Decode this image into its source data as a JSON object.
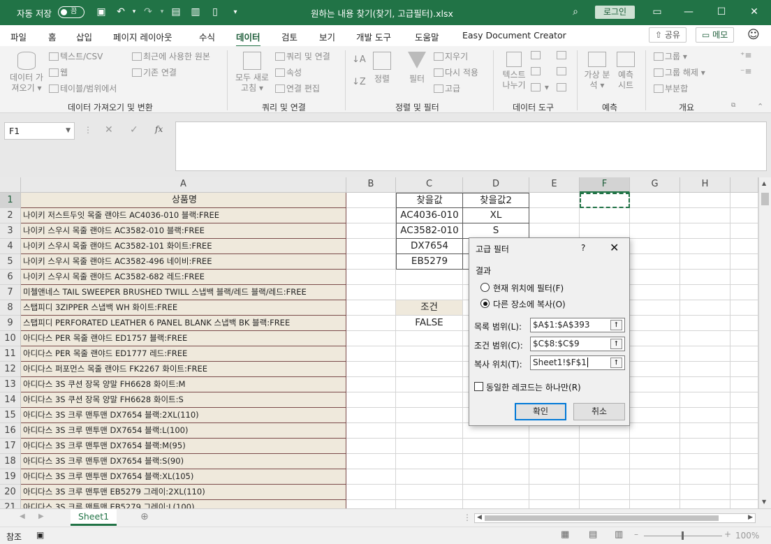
{
  "app": {
    "autosave_label": "자동 저장",
    "autosave_state": "끔",
    "title": "원하는 내용 찾기(찾기, 고급필터).xlsx",
    "login": "로그인"
  },
  "tabs": [
    "파일",
    "홈",
    "삽입",
    "페이지 레이아웃",
    "수식",
    "데이터",
    "검토",
    "보기",
    "개발 도구",
    "도움말",
    "Easy Document Creator"
  ],
  "menu_right": {
    "share": "공유",
    "memo": "메모"
  },
  "ribbon": {
    "get_data": {
      "btn": "데이터 가져오기",
      "items": [
        "텍스트/CSV",
        "웹",
        "테이블/범위에서",
        "최근에 사용한 원본",
        "기존 연결"
      ],
      "group": "데이터 가져오기 및 변환"
    },
    "queries": {
      "btn": "모두 새로 고침",
      "items": [
        "쿼리 및 연결",
        "속성",
        "연결 편집"
      ],
      "group": "쿼리 및 연결"
    },
    "sort": {
      "sort": "정렬",
      "filter": "필터",
      "items": [
        "지우기",
        "다시 적용",
        "고급"
      ],
      "group": "정렬 및 필터"
    },
    "tools": {
      "btn": "텍스트 나누기",
      "group": "데이터 도구"
    },
    "forecast": {
      "whatif": "가상 분석",
      "sheet": "예측 시트",
      "group": "예측"
    },
    "outline": {
      "items": [
        "그룹",
        "그룹 해제",
        "부분합"
      ],
      "group": "개요"
    }
  },
  "namebox": "F1",
  "columns": [
    "A",
    "B",
    "C",
    "D",
    "E",
    "F",
    "G",
    "H"
  ],
  "rows": [
    {
      "n": "1",
      "a": "상품명",
      "c": "찾을값",
      "d": "찾을값2"
    },
    {
      "n": "2",
      "a": "나이키 저스트두잇 목줄 랜야드 AC4036-010 블랙:FREE",
      "c": "AC4036-010",
      "d": "XL"
    },
    {
      "n": "3",
      "a": "나이키 스우시 목줄 랜야드 AC3582-010 블랙:FREE",
      "c": "AC3582-010",
      "d": "S"
    },
    {
      "n": "4",
      "a": "나이키 스우시 목줄 랜야드 AC3582-101 화이트:FREE",
      "c": "DX7654",
      "d": ""
    },
    {
      "n": "5",
      "a": "나이키 스우시 목줄 랜야드 AC3582-496 네이비:FREE",
      "c": "EB5279",
      "d": ""
    },
    {
      "n": "6",
      "a": "나이키 스우시 목줄 랜야드 AC3582-682 레드:FREE",
      "c": "",
      "d": ""
    },
    {
      "n": "7",
      "a": "미첼앤네스 TAIL SWEEPER BRUSHED TWILL 스냅백 블랙/레드 블랙/레드:FREE",
      "c": "",
      "d": ""
    },
    {
      "n": "8",
      "a": "스탭피디 3ZIPPER 스냅백 WH 화이트:FREE",
      "c": "조건",
      "d": ""
    },
    {
      "n": "9",
      "a": "스탭피디 PERFORATED LEATHER 6 PANEL BLANK 스냅백 BK 블랙:FREE",
      "c": "FALSE",
      "d": ""
    },
    {
      "n": "10",
      "a": "아디다스 PER 목줄 랜야드 ED1757 블랙:FREE",
      "c": "",
      "d": ""
    },
    {
      "n": "11",
      "a": "아디다스 PER 목줄 랜야드 ED1777 레드:FREE",
      "c": "",
      "d": ""
    },
    {
      "n": "12",
      "a": "아디다스 퍼포먼스 목줄 랜야드 FK2267 화이트:FREE",
      "c": "",
      "d": ""
    },
    {
      "n": "13",
      "a": "아디다스 3S 쿠션 장목 양말 FH6628 화이트:M",
      "c": "",
      "d": ""
    },
    {
      "n": "14",
      "a": "아디다스 3S 쿠션 장목 양말 FH6628 화이트:S",
      "c": "",
      "d": ""
    },
    {
      "n": "15",
      "a": "아디다스 3S 크루 맨투맨 DX7654 블랙:2XL(110)",
      "c": "",
      "d": ""
    },
    {
      "n": "16",
      "a": "아디다스 3S 크루 맨투맨 DX7654 블랙:L(100)",
      "c": "",
      "d": ""
    },
    {
      "n": "17",
      "a": "아디다스 3S 크루 맨투맨 DX7654 블랙:M(95)",
      "c": "",
      "d": ""
    },
    {
      "n": "18",
      "a": "아디다스 3S 크루 맨투맨 DX7654 블랙:S(90)",
      "c": "",
      "d": ""
    },
    {
      "n": "19",
      "a": "아디다스 3S 크루 맨투맨 DX7654 블랙:XL(105)",
      "c": "",
      "d": ""
    },
    {
      "n": "20",
      "a": "아디다스 3S 크루 맨투맨 EB5279 그레이:2XL(110)",
      "c": "",
      "d": ""
    },
    {
      "n": "21",
      "a": "아디다스 3S 크루 맨투맨 EB5279 그레이:L(100)",
      "c": "",
      "d": ""
    }
  ],
  "sheet_tab": "Sheet1",
  "status": {
    "mode": "참조",
    "zoom": "100%"
  },
  "dialog": {
    "title": "고급 필터",
    "help": "?",
    "section": "결과",
    "opt1": "현재 위치에 필터(F)",
    "opt2": "다른 장소에 복사(O)",
    "list_label": "목록 범위(L):",
    "list_value": "$A$1:$A$393",
    "crit_label": "조건 범위(C):",
    "crit_value": "$C$8:$C$9",
    "copy_label": "복사 위치(T):",
    "copy_value": "Sheet1!$F$1",
    "unique_label": "동일한 레코드는 하나만(R)",
    "ok": "확인",
    "cancel": "취소"
  }
}
